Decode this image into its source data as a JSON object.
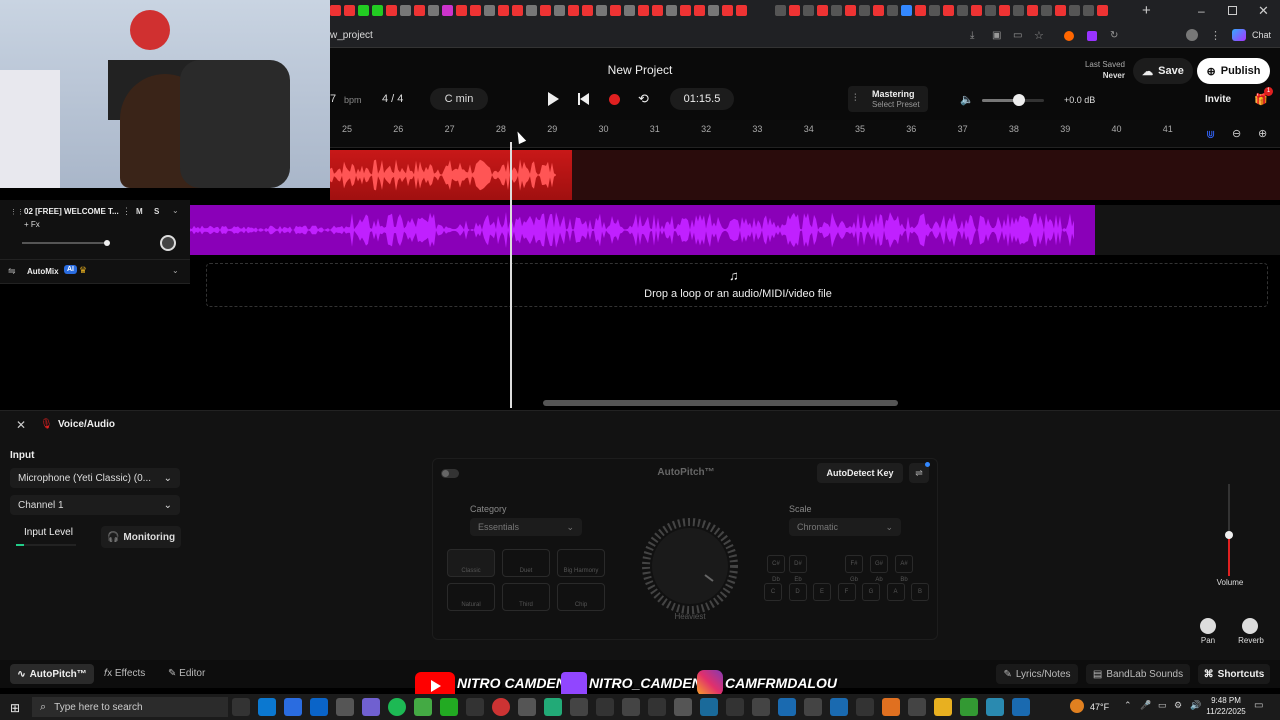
{
  "browser": {
    "url": "w_project",
    "chat_label": "Chat"
  },
  "project": {
    "title": "New Project",
    "last_saved_label": "Last Saved",
    "last_saved_value": "Never",
    "save_label": "Save",
    "publish_label": "Publish",
    "invite_label": "Invite",
    "gift_badge": "1"
  },
  "transport": {
    "bpm_value": "7",
    "bpm_unit": "bpm",
    "time_signature": "4 / 4",
    "key": "C min",
    "time": "01:15.5"
  },
  "mastering": {
    "label": "Mastering",
    "preset": "Select Preset",
    "volume_db": "+0.0 dB",
    "volume_level": 0.6
  },
  "ruler": {
    "bars": [
      "25",
      "26",
      "27",
      "28",
      "29",
      "30",
      "31",
      "32",
      "33",
      "34",
      "35",
      "36",
      "37",
      "38",
      "39",
      "40",
      "41"
    ]
  },
  "tracks": [
    {
      "name": "02  [FREE] WELCOME T...",
      "fx": "+ Fx",
      "mute": "M",
      "solo": "S",
      "color": "#b000e0"
    }
  ],
  "automix": {
    "label": "AutoMix",
    "ai_badge": "AI"
  },
  "dropzone": {
    "text": "Drop a loop or an audio/MIDI/video file"
  },
  "panel": {
    "title": "Voice/Audio",
    "input_label": "Input",
    "input_device": "Microphone (Yeti Classic) (0...",
    "channel": "Channel 1",
    "input_level_label": "Input Level",
    "monitoring_label": "Monitoring"
  },
  "autopitch": {
    "title": "AutoPitch™",
    "autodetect_label": "AutoDetect Key",
    "category_label": "Category",
    "category_value": "Essentials",
    "scale_label": "Scale",
    "scale_value": "Chromatic",
    "knob_label": "Heaviest",
    "modes": [
      "Classic",
      "Duet",
      "Big Harmony",
      "Natural",
      "Third",
      "Chip"
    ],
    "sharp_keys": [
      "C# Db",
      "D# Eb",
      "F# Gb",
      "G# Ab",
      "A# Bb"
    ],
    "natural_keys": [
      "C",
      "D",
      "E",
      "F",
      "G",
      "A",
      "B"
    ]
  },
  "mixer": {
    "volume_label": "Volume",
    "pan_label": "Pan",
    "reverb_label": "Reverb",
    "volume_level": 0.45
  },
  "bottom_tabs": {
    "autopitch": "AutoPitch™",
    "effects": "Effects",
    "editor": "Editor",
    "lyrics": "Lyrics/Notes",
    "sounds": "BandLab Sounds",
    "shortcuts": "Shortcuts"
  },
  "overlay": {
    "youtube": "NITRO CAMDEN",
    "twitch": "NITRO_CAMDEN",
    "instagram": "CAMFRMDALOU"
  },
  "taskbar": {
    "search_placeholder": "Type here to search",
    "temperature": "47°F",
    "time": "9:48 PM",
    "date": "11/22/2025"
  },
  "colors": {
    "accent_red": "#e02020",
    "accent_purple": "#b000e0",
    "youtube_red": "#ff0000",
    "twitch_purple": "#9146ff"
  }
}
